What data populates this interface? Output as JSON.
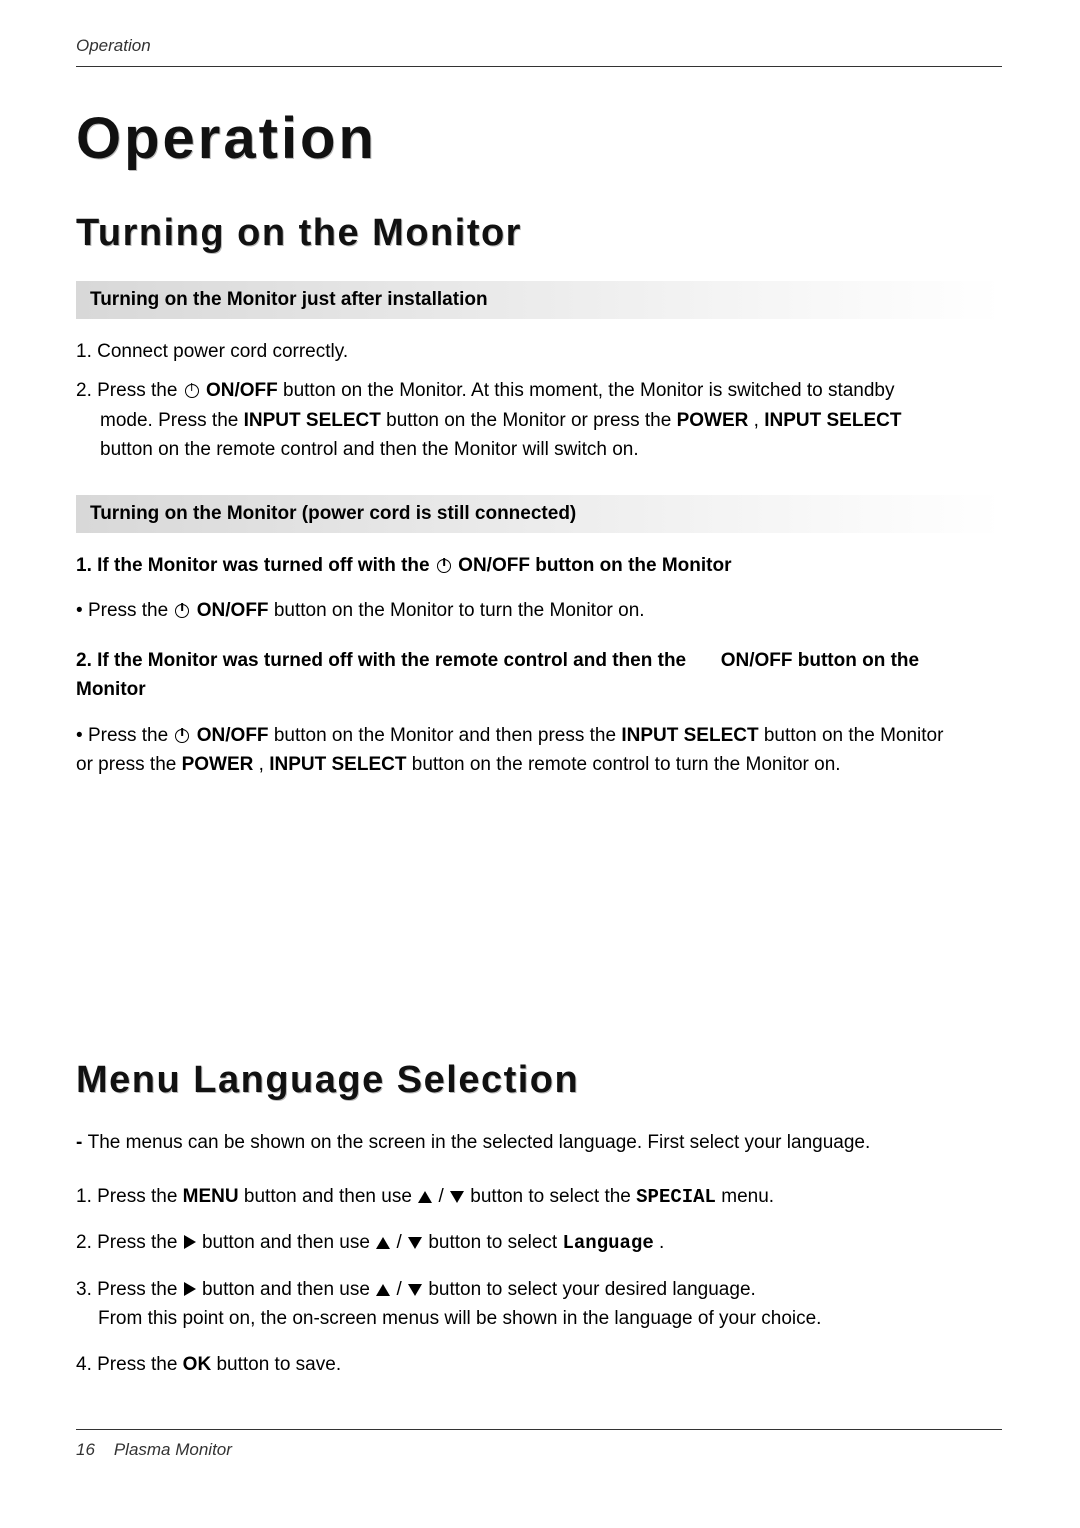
{
  "header": {
    "running": "Operation"
  },
  "title": "Operation",
  "section1": {
    "heading": "Turning on the Monitor",
    "banner1": "Turning on the Monitor just after installation",
    "step1": "1. Connect power cord correctly.",
    "step2_a": "2. Press the ",
    "step2_b": "ON/OFF",
    "step2_c": " button on the Monitor. At this moment, the Monitor is switched to standby mode. Press the ",
    "step2_d": "INPUT SELECT",
    "step2_e": " button on the Monitor or press the ",
    "step2_f": "POWER",
    "step2_g": ", ",
    "step2_h": "INPUT SELECT",
    "step2_i": " button on the remote control and then the Monitor will switch on.",
    "banner2": "Turning on the Monitor (power cord is still connected)",
    "scen1_a": "1. If the Monitor was turned off with the ",
    "scen1_b": " ON/OFF button on the Monitor",
    "scen1_note_a": "Press the ",
    "scen1_note_b": "ON/OFF",
    "scen1_note_c": " button on the Monitor to turn the Monitor on.",
    "scen2_a": "2. If the Monitor was turned off  with the remote control and then the ",
    "scen2_b": " ON/OFF button on the Monitor",
    "scen2_note_a": "Press the ",
    "scen2_note_b": "ON/OFF",
    "scen2_note_c": " button on the Monitor and then press the ",
    "scen2_note_d": "INPUT SELECT",
    "scen2_note_e": "  button on the Monitor or press the ",
    "scen2_note_f": "POWER",
    "scen2_note_g": ", ",
    "scen2_note_h": "INPUT SELECT",
    "scen2_note_i": " button on the remote control to turn the Monitor on."
  },
  "section2": {
    "heading": "Menu Language Selection",
    "intro": "The menus can be shown on the screen in the selected language. First select your language.",
    "s1_a": "1.  Press the ",
    "s1_b": "MENU",
    "s1_c": " button and then use ",
    "s1_d": " button to select the ",
    "s1_e": "SPECIAL",
    "s1_f": " menu.",
    "s2_a": "2.  Press the ",
    "s2_b": " button and then use ",
    "s2_c": " button to select ",
    "s2_d": "Language",
    "s2_e": ".",
    "s3_a": "3.  Press the ",
    "s3_b": " button and then use ",
    "s3_c": " button to select your desired language.",
    "s3_d": "From this point on, the on-screen menus will be shown in the language of your choice.",
    "s4_a": "4.  Press the ",
    "s4_b": "OK",
    "s4_c": " button to save."
  },
  "footer": {
    "page_num": "16",
    "label": "Plasma Monitor"
  },
  "glyphs": {
    "slash": " / ",
    "bullet": "•  ",
    "dash": "-  "
  }
}
